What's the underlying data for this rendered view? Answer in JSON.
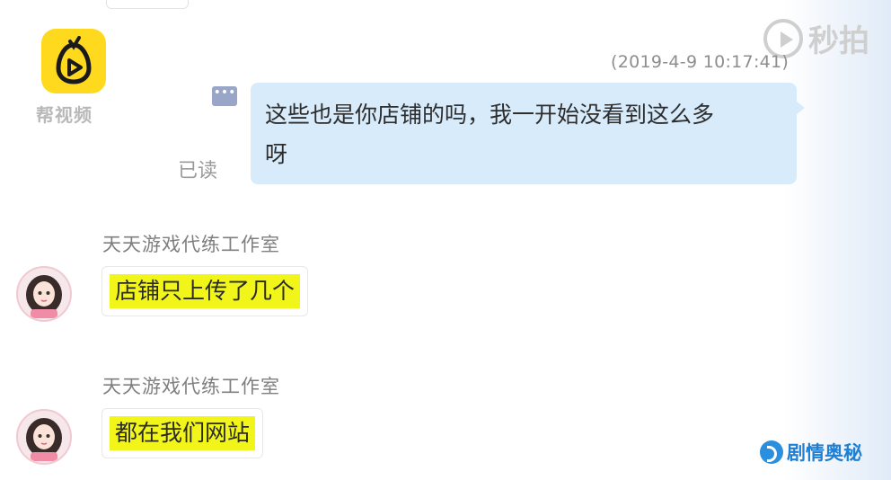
{
  "header": {
    "app_name": "帮视频",
    "watermark_top": "秒拍",
    "timestamp": "(2019-4-9 10:17:41)"
  },
  "messages": [
    {
      "direction": "outgoing",
      "status_icon": "more-dots-icon",
      "read_label": "已读",
      "text_line1": "这些也是你店铺的吗，我一开始没看到这么多",
      "text_line2": "呀"
    },
    {
      "direction": "incoming",
      "sender": "天天游戏代练工作室",
      "text": "店铺只上传了几个"
    },
    {
      "direction": "incoming",
      "sender": "天天游戏代练工作室",
      "text": "都在我们网站"
    }
  ],
  "footer": {
    "watermark_bottom": "剧情奥秘"
  },
  "colors": {
    "outgoing_bubble": "#d8ebfb",
    "highlight": "#f1f51a",
    "logo_yellow": "#ffd91e"
  }
}
